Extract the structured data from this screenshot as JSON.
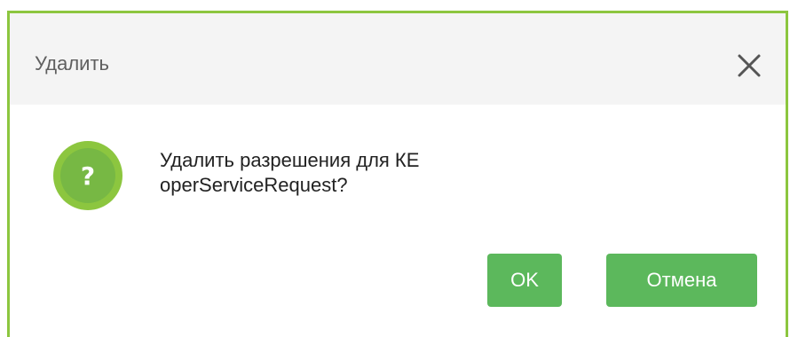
{
  "dialog": {
    "title": "Удалить",
    "close_icon": "close-icon",
    "question_icon": "question-circle-icon",
    "message_line1": "Удалить разрешения для КЕ",
    "message_line2": "operServiceRequest?",
    "ok_label": "OK",
    "cancel_label": "Отмена"
  },
  "colors": {
    "accent": "#8cc63f",
    "button": "#5cb85c",
    "icon": "#77b844",
    "header_bg": "#f4f4f4"
  }
}
